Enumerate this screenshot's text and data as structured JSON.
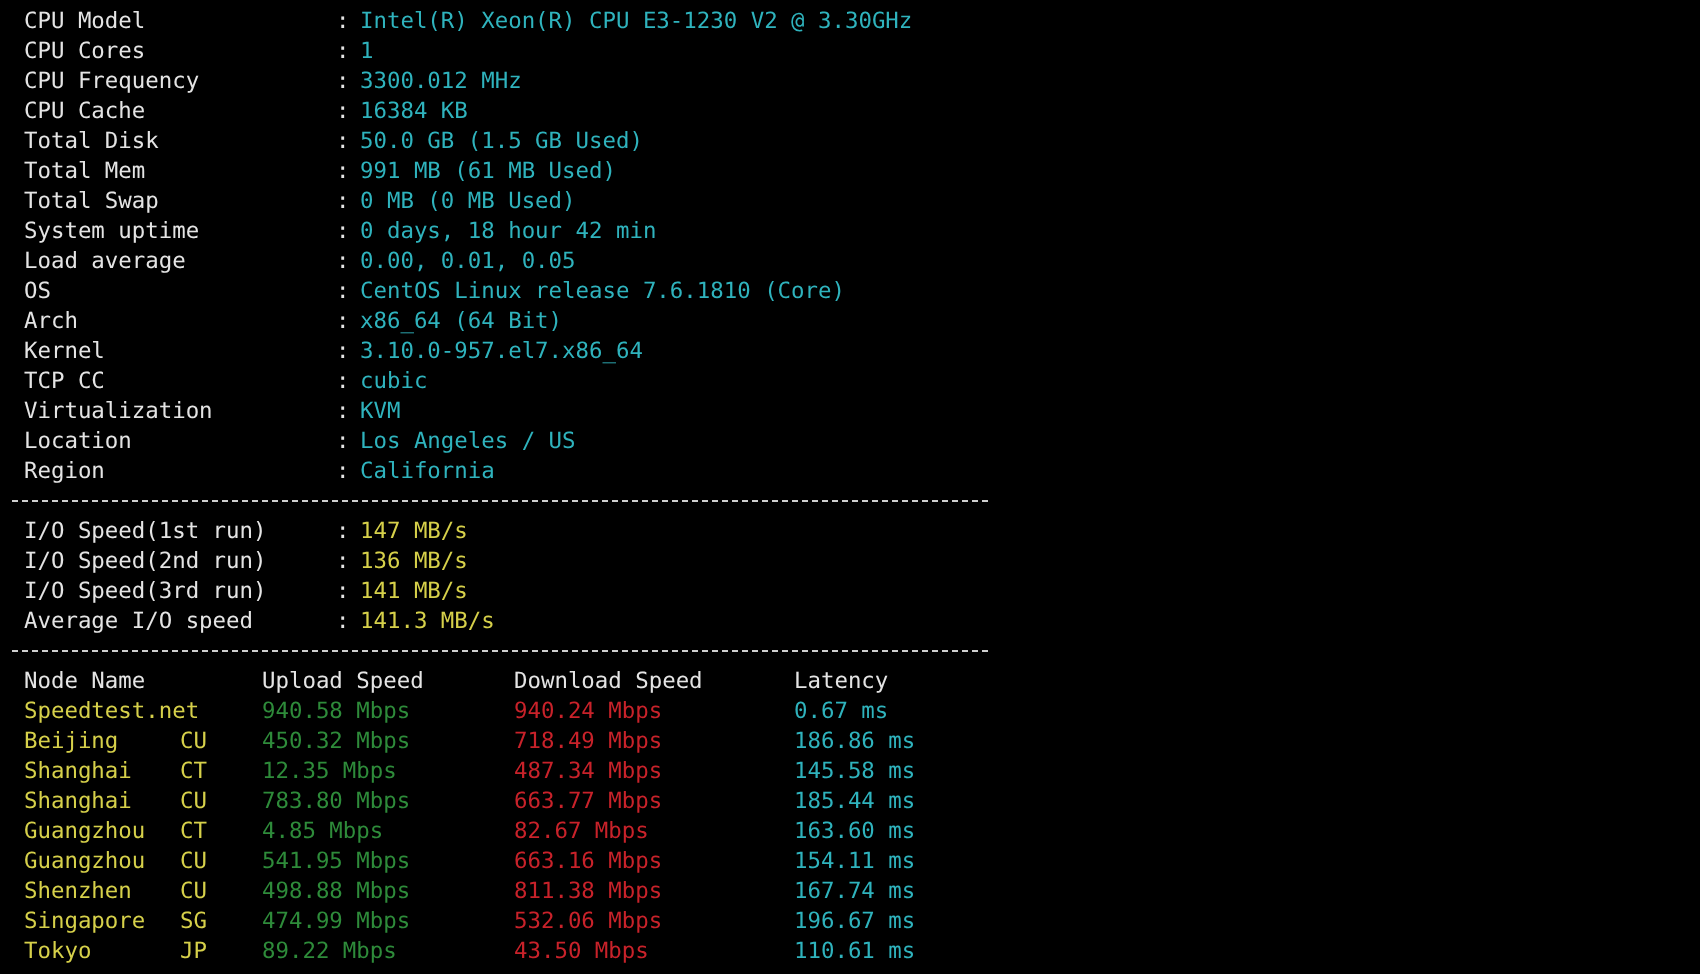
{
  "system_info": [
    {
      "label": "CPU Model",
      "sep": ":",
      "value": "Intel(R) Xeon(R) CPU E3-1230 V2 @ 3.30GHz"
    },
    {
      "label": "CPU Cores",
      "sep": ":",
      "value": "1"
    },
    {
      "label": "CPU Frequency",
      "sep": ":",
      "value": "3300.012 MHz"
    },
    {
      "label": "CPU Cache",
      "sep": ":",
      "value": "16384 KB"
    },
    {
      "label": "Total Disk",
      "sep": ":",
      "value": "50.0 GB (1.5 GB Used)"
    },
    {
      "label": "Total Mem",
      "sep": ":",
      "value": "991 MB (61 MB Used)"
    },
    {
      "label": "Total Swap",
      "sep": ":",
      "value": "0 MB (0 MB Used)"
    },
    {
      "label": "System uptime",
      "sep": ":",
      "value": "0 days, 18 hour 42 min"
    },
    {
      "label": "Load average",
      "sep": ":",
      "value": "0.00, 0.01, 0.05"
    },
    {
      "label": "OS",
      "sep": ":",
      "value": "CentOS Linux release 7.6.1810 (Core)"
    },
    {
      "label": "Arch",
      "sep": ":",
      "value": "x86_64 (64 Bit)"
    },
    {
      "label": "Kernel",
      "sep": ":",
      "value": "3.10.0-957.el7.x86_64"
    },
    {
      "label": "TCP CC",
      "sep": ":",
      "value": "cubic"
    },
    {
      "label": "Virtualization",
      "sep": ":",
      "value": "KVM"
    },
    {
      "label": "Location",
      "sep": ":",
      "value": "Los Angeles / US"
    },
    {
      "label": "Region",
      "sep": ":",
      "value": "California"
    }
  ],
  "io_speed": [
    {
      "label": "I/O Speed(1st run)",
      "sep": ":",
      "value": "147 MB/s"
    },
    {
      "label": "I/O Speed(2nd run)",
      "sep": ":",
      "value": "136 MB/s"
    },
    {
      "label": "I/O Speed(3rd run)",
      "sep": ":",
      "value": "141 MB/s"
    },
    {
      "label": "Average I/O speed",
      "sep": ":",
      "value": "141.3 MB/s"
    }
  ],
  "speedtest": {
    "columns": [
      "Node Name",
      "Upload Speed",
      "Download Speed",
      "Latency"
    ],
    "rows": [
      {
        "node": "Speedtest.net",
        "upload": "940.58 Mbps",
        "download": "940.24 Mbps",
        "latency": "0.67 ms"
      },
      {
        "node": "Beijing",
        "isp": "CU",
        "upload": "450.32 Mbps",
        "download": "718.49 Mbps",
        "latency": "186.86 ms"
      },
      {
        "node": "Shanghai",
        "isp": "CT",
        "upload": "12.35 Mbps",
        "download": "487.34 Mbps",
        "latency": "145.58 ms"
      },
      {
        "node": "Shanghai",
        "isp": "CU",
        "upload": "783.80 Mbps",
        "download": "663.77 Mbps",
        "latency": "185.44 ms"
      },
      {
        "node": "Guangzhou",
        "isp": "CT",
        "upload": "4.85 Mbps",
        "download": "82.67 Mbps",
        "latency": "163.60 ms"
      },
      {
        "node": "Guangzhou",
        "isp": "CU",
        "upload": "541.95 Mbps",
        "download": "663.16 Mbps",
        "latency": "154.11 ms"
      },
      {
        "node": "Shenzhen",
        "isp": "CU",
        "upload": "498.88 Mbps",
        "download": "811.38 Mbps",
        "latency": "167.74 ms"
      },
      {
        "node": "Singapore",
        "isp": "SG",
        "upload": "474.99 Mbps",
        "download": "532.06 Mbps",
        "latency": "196.67 ms"
      },
      {
        "node": "Tokyo",
        "isp": "JP",
        "upload": "89.22 Mbps",
        "download": "43.50 Mbps",
        "latency": "110.61 ms"
      }
    ]
  }
}
